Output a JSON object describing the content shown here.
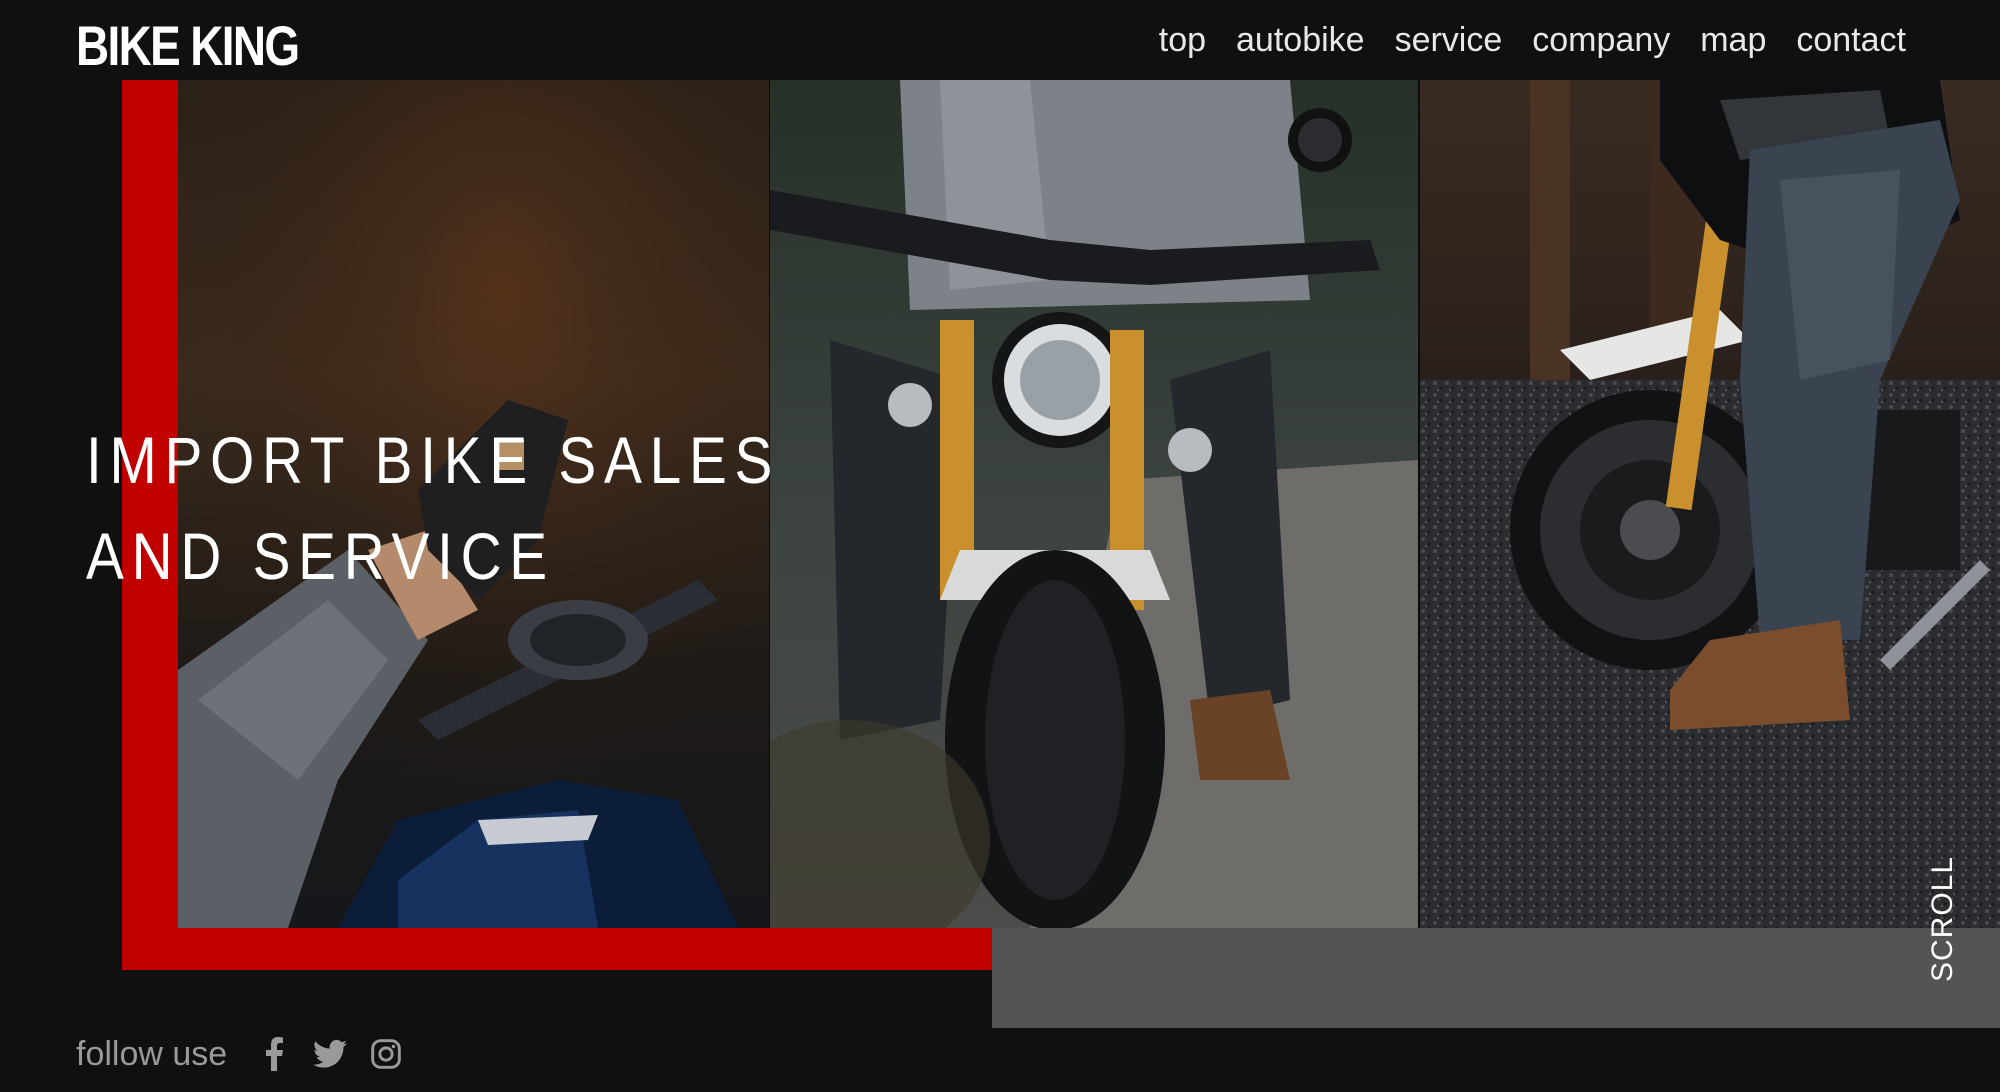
{
  "header": {
    "logo": "BIKE KING",
    "nav": [
      "top",
      "autobike",
      "service",
      "company",
      "map",
      "contact"
    ]
  },
  "hero": {
    "line1": "IMPORT BIKE SALES",
    "line2": "AND SERVICE"
  },
  "scroll_label": "SCROLL",
  "footer": {
    "follow_label": "follow use",
    "social_icons": [
      "facebook-icon",
      "twitter-icon",
      "instagram-icon"
    ]
  },
  "colors": {
    "background": "#101010",
    "accent_red": "#c10000",
    "gray_bar": "#545454"
  }
}
